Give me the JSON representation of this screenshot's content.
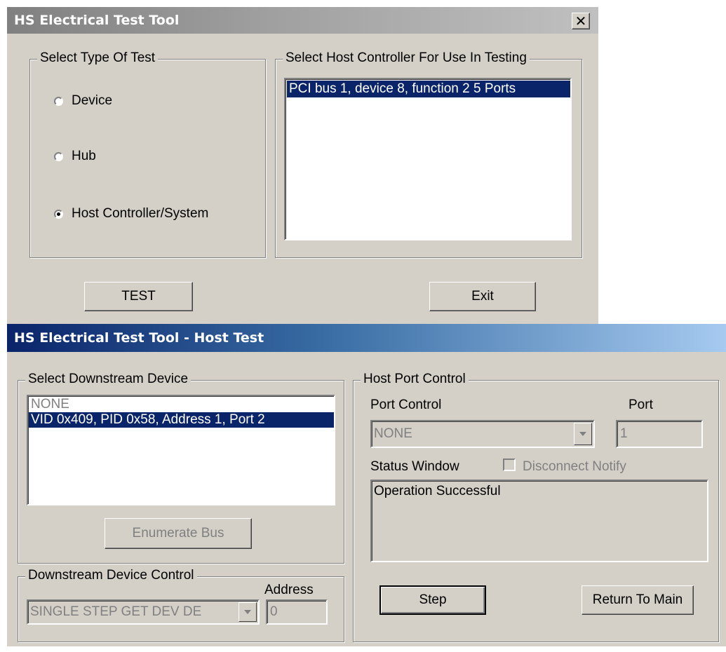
{
  "main_window": {
    "title": "HS Electrical Test Tool",
    "close_glyph": "✕",
    "test_type_group": {
      "label": "Select Type Of Test",
      "options": [
        {
          "label": "Device",
          "selected": false
        },
        {
          "label": "Hub",
          "selected": false
        },
        {
          "label": "Host Controller/System",
          "selected": true
        }
      ]
    },
    "host_controller_group": {
      "label": "Select Host Controller For Use In Testing",
      "items": [
        "PCI bus 1, device 8, function 2  5 Ports"
      ],
      "selected_index": 0
    },
    "test_button": "TEST",
    "exit_button": "Exit"
  },
  "host_window": {
    "title": "HS Electrical Test Tool - Host Test",
    "downstream_group": {
      "label": "Select Downstream Device",
      "items": [
        "NONE",
        "VID 0x409, PID 0x58, Address 1, Port 2"
      ],
      "selected_index": 1
    },
    "enumerate_button": "Enumerate Bus",
    "device_control_group": {
      "label": "Downstream Device Control",
      "dropdown_value": "SINGLE STEP GET DEV DE",
      "address_label": "Address",
      "address_value": "0"
    },
    "host_port_group": {
      "label": "Host Port Control",
      "port_control_label": "Port Control",
      "port_control_value": "NONE",
      "port_label": "Port",
      "port_value": "1",
      "status_label": "Status Window",
      "disconnect_notify_label": "Disconnect Notify",
      "disconnect_notify_checked": false,
      "status_text": "Operation Successful"
    },
    "step_button": "Step",
    "return_button": "Return To Main"
  },
  "colors": {
    "face": "#d4d0c8",
    "selection": "#0a246a",
    "active_title_start": "#0a246a",
    "active_title_end": "#a6caf0",
    "inactive_title": "#808080"
  }
}
